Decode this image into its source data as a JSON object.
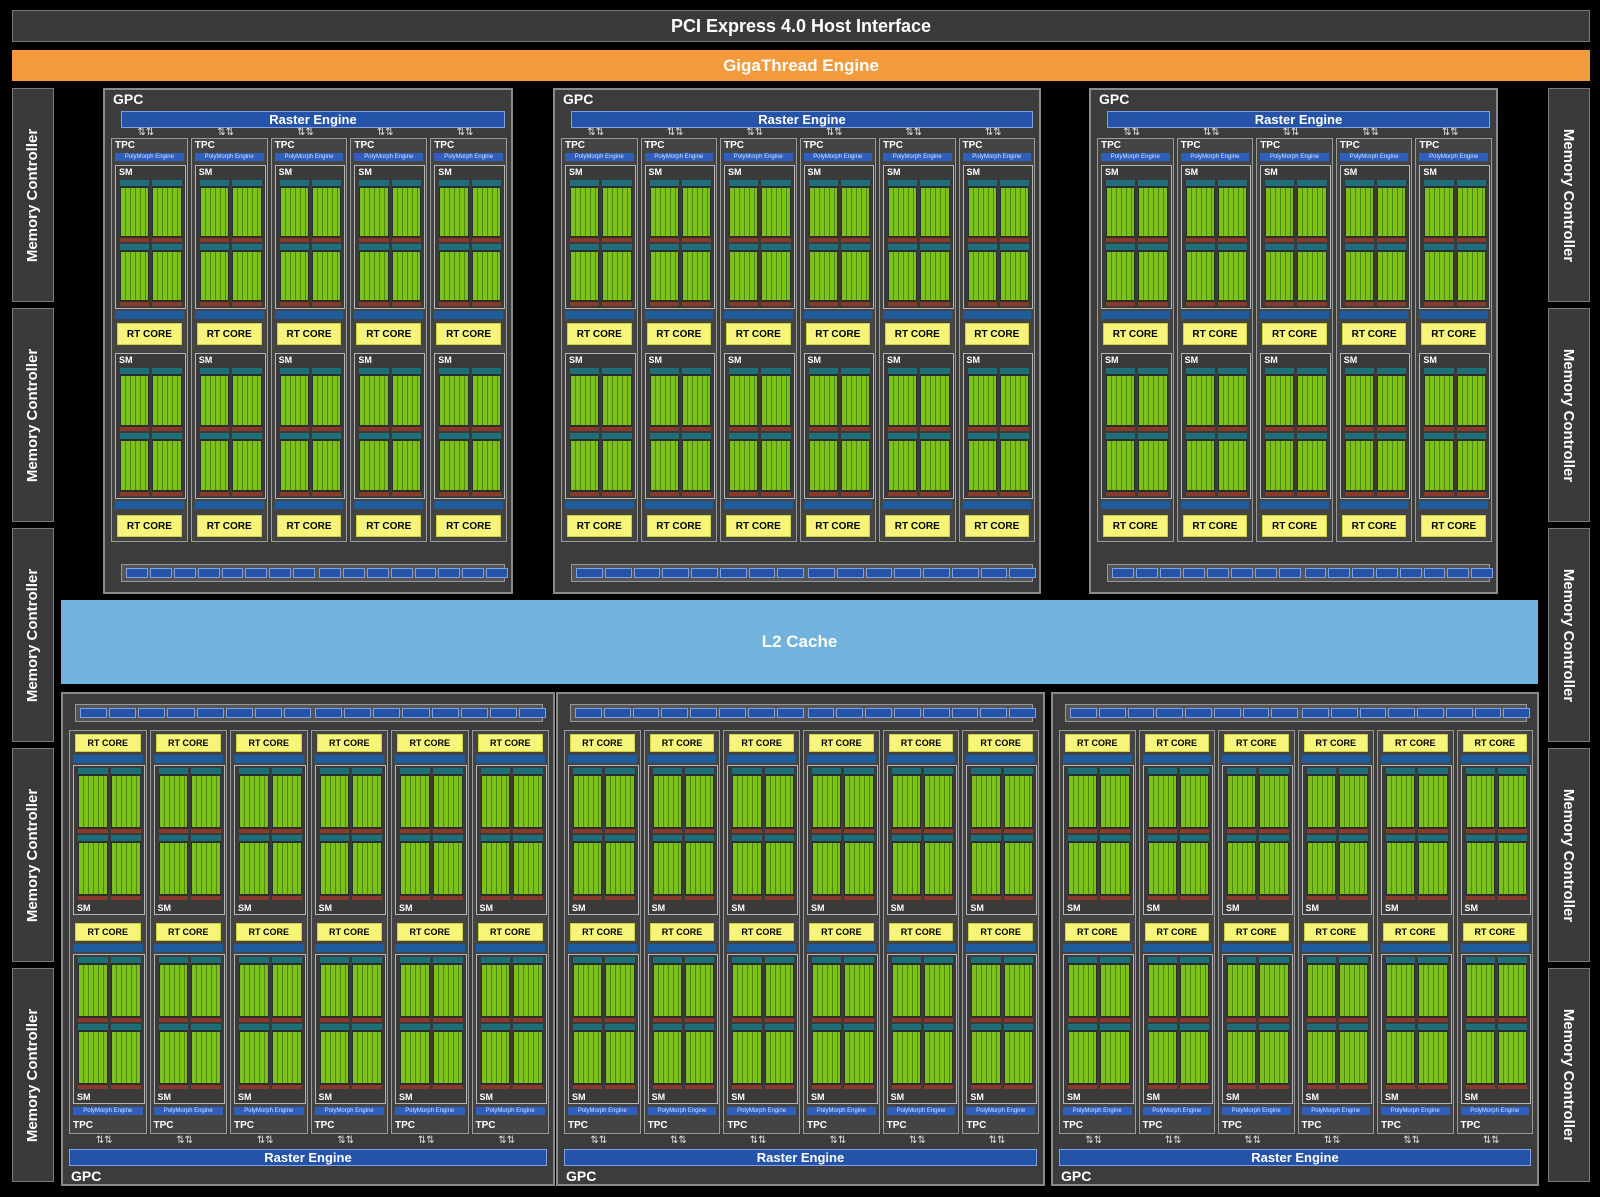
{
  "host_interface": "PCI Express 4.0 Host Interface",
  "gigathread": "GigaThread Engine",
  "l2_cache": "L2 Cache",
  "memory_controller_label": "Memory Controller",
  "gpc_label": "GPC",
  "raster_label": "Raster Engine",
  "tpc_label": "TPC",
  "polymorph_label": "PolyMorph Engine",
  "sm_label": "SM",
  "rt_label": "RT CORE",
  "colors": {
    "background": "#000000",
    "host_interface": "#3a3a3a",
    "gigathread": "#f39a3d",
    "l2": "#72b3de",
    "raster": "#2453a8",
    "rt_core": "#f6f57a",
    "cuda_core": "#7cc21a"
  }
}
